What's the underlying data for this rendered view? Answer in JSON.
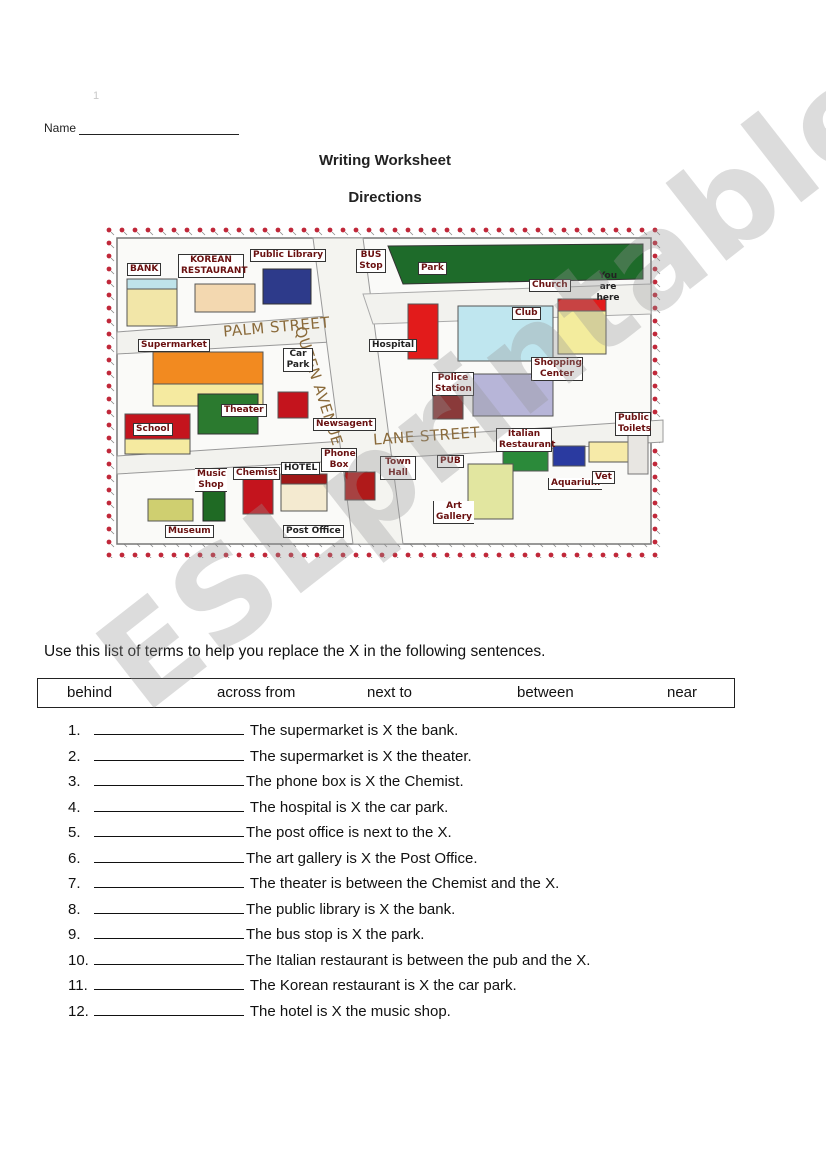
{
  "page_number": "1",
  "name_label": "Name",
  "title": "Writing Worksheet",
  "subtitle": "Directions",
  "map": {
    "streets": [
      "PALM STREET",
      "QUEEN AVENUE",
      "LANE STREET"
    ],
    "labels": {
      "bank": "BANK",
      "korean_restaurant": "KOREAN RESTAURANT",
      "public_library": "Public Library",
      "bus_stop": "BUS Stop",
      "park": "Park",
      "church": "Church",
      "you_are_here": "You are here",
      "club": "Club",
      "hospital": "Hospital",
      "supermarket": "Supermarket",
      "car_park": "Car Park",
      "police_station": "Police Station",
      "shopping_center": "Shopping Center",
      "theater": "Theater",
      "school": "School",
      "newsagent": "Newsagent",
      "public_toilets": "Public Toilets",
      "italian_restaurant": "Italian Restaurant",
      "music_shop": "Music Shop",
      "chemist": "Chemist",
      "hotel": "HOTEL",
      "phone_box": "Phone Box",
      "town_hall": "Town Hall",
      "pub": "PUB",
      "aquarium": "Aquarium",
      "vet": "Vet",
      "museum": "Museum",
      "post_office": "Post Office",
      "art_gallery": "Art Gallery"
    }
  },
  "instructions": "Use this list of terms to help you replace the X in the following sentences.",
  "terms": [
    "behind",
    "across from",
    "next to",
    "between",
    "near"
  ],
  "questions": [
    {
      "num": "1.",
      "text": " The supermarket is X the bank."
    },
    {
      "num": "2.",
      "text": " The supermarket is X the theater."
    },
    {
      "num": "3.",
      "text": "The phone box is X the Chemist."
    },
    {
      "num": "4.",
      "text": " The hospital is X the car park."
    },
    {
      "num": "5.",
      "text": "The post office is next to the X."
    },
    {
      "num": "6.",
      "text": "The art gallery is X the Post Office."
    },
    {
      "num": "7.",
      "text": " The theater is between the Chemist and the X."
    },
    {
      "num": "8.",
      "text": "The public library is X the bank."
    },
    {
      "num": "9.",
      "text": "The bus stop is X the park."
    },
    {
      "num": "10.",
      "text": "The Italian restaurant is between the pub and the X."
    },
    {
      "num": "11.",
      "text": " The Korean restaurant is X the car park."
    },
    {
      "num": "12.",
      "text": " The hotel is X the music shop."
    }
  ],
  "watermark": "ESLprintables.com"
}
